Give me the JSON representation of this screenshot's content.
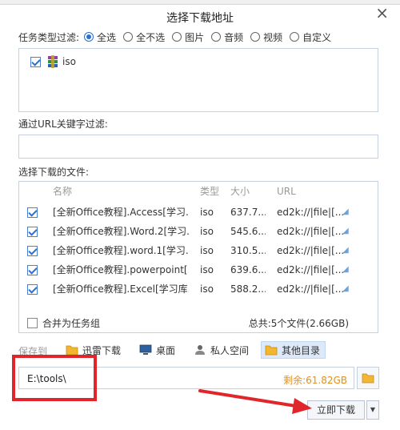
{
  "dialog": {
    "title": "选择下载地址",
    "close_glyph": "×"
  },
  "type_filter": {
    "label": "任务类型过滤:",
    "options": [
      {
        "label": "全选",
        "selected": true
      },
      {
        "label": "全不选",
        "selected": false
      },
      {
        "label": "图片",
        "selected": false
      },
      {
        "label": "音频",
        "selected": false
      },
      {
        "label": "视频",
        "selected": false
      },
      {
        "label": "自定义",
        "selected": false
      }
    ],
    "types": [
      {
        "label": "iso",
        "checked": true,
        "icon": "rar-archive-icon"
      }
    ]
  },
  "url_filter": {
    "label": "通过URL关键字过滤:",
    "value": ""
  },
  "files": {
    "label": "选择下载的文件:",
    "columns": {
      "name": "名称",
      "type": "类型",
      "size": "大小",
      "url": "URL"
    },
    "rows": [
      {
        "checked": true,
        "name": "[全新Office教程].Access[学习...",
        "type": "iso",
        "size": "637.7...",
        "url": "ed2k://|file|[..."
      },
      {
        "checked": true,
        "name": "[全新Office教程].Word.2[学习...",
        "type": "iso",
        "size": "545.6...",
        "url": "ed2k://|file|[..."
      },
      {
        "checked": true,
        "name": "[全新Office教程].word.1[学习...",
        "type": "iso",
        "size": "310.5...",
        "url": "ed2k://|file|[..."
      },
      {
        "checked": true,
        "name": "[全新Office教程].powerpoint[...",
        "type": "iso",
        "size": "639.6...",
        "url": "ed2k://|file|[..."
      },
      {
        "checked": true,
        "name": "[全新Office教程].Excel[学习库...",
        "type": "iso",
        "size": "588.2...",
        "url": "ed2k://|file|[..."
      }
    ],
    "merge_label": "合并为任务组",
    "merge_checked": false,
    "total": "总共:5个文件(2.66GB)"
  },
  "save_to": {
    "label": "保存到",
    "locations": [
      {
        "label": "迅雷下载",
        "icon": "folder-icon",
        "active": false
      },
      {
        "label": "桌面",
        "icon": "desktop-icon",
        "active": false
      },
      {
        "label": "私人空间",
        "icon": "private-space-icon",
        "active": false
      },
      {
        "label": "其他目录",
        "icon": "folder-icon",
        "active": true
      }
    ],
    "path": "E:\\tools\\",
    "remaining": "剩余:61.82GB"
  },
  "actions": {
    "download_now": "立即下载",
    "dropdown_glyph": "▼"
  },
  "colors": {
    "accent": "#2a6fd6",
    "remaining": "#e38f1f",
    "highlight_box": "#e0262b",
    "arrow": "#e0262b"
  }
}
